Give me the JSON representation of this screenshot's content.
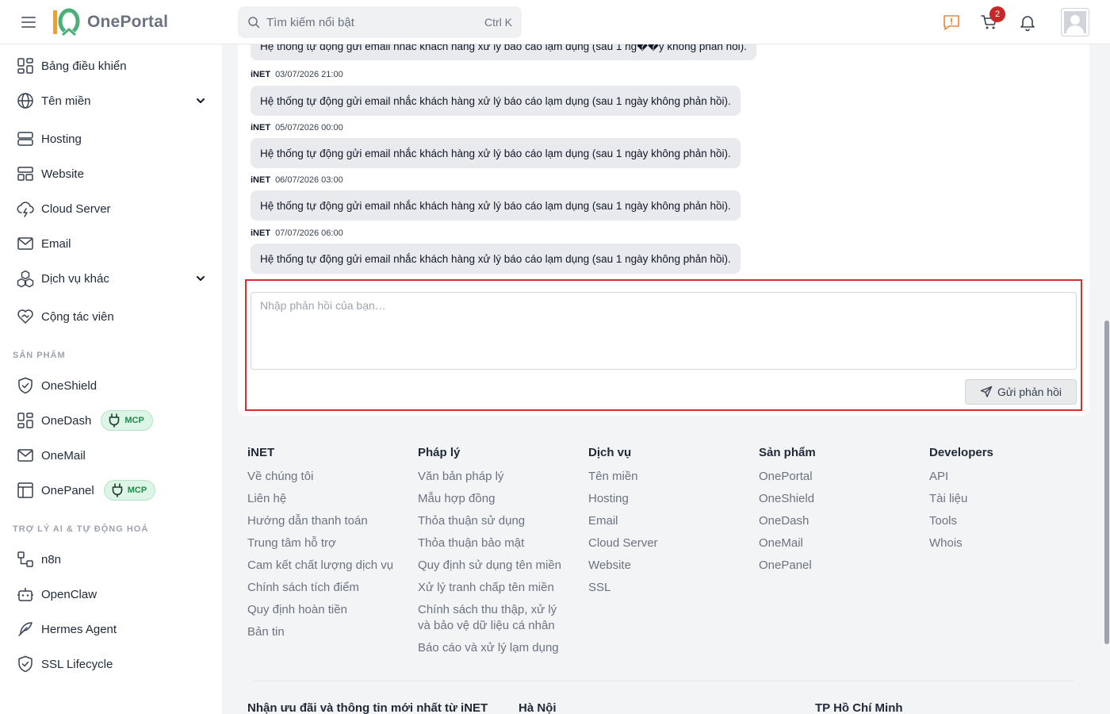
{
  "header": {
    "logo_mark": "10",
    "logo_text": "OnePortal",
    "search_placeholder": "Tìm kiếm nổi bật",
    "search_shortcut": "Ctrl K",
    "cart_count": "2"
  },
  "sidebar": {
    "items": [
      {
        "label": "Bảng điều khiển",
        "icon": "dashboard-icon"
      },
      {
        "label": "Tên miền",
        "icon": "globe-icon"
      },
      {
        "label": "Hosting",
        "icon": "server-icon"
      },
      {
        "label": "Website",
        "icon": "layout-icon"
      },
      {
        "label": "Cloud Server",
        "icon": "cloud-lightning-icon"
      },
      {
        "label": "Email",
        "icon": "mail-icon"
      },
      {
        "label": "Dịch vụ khác",
        "icon": "boxes-icon"
      },
      {
        "label": "Cộng tác viên",
        "icon": "handshake-heart-icon"
      }
    ],
    "products_title": "SẢN PHẨM",
    "products": [
      {
        "label": "OneShield",
        "icon": "shield-check-icon"
      },
      {
        "label": "OneDash",
        "icon": "dashboard-icon",
        "badge": "MCP"
      },
      {
        "label": "OneMail",
        "icon": "mail-icon"
      },
      {
        "label": "OnePanel",
        "icon": "panel-icon",
        "badge": "MCP"
      }
    ],
    "ai_title": "TRỢ LÝ AI & TỰ ĐỘNG HOÁ",
    "ai_items": [
      {
        "label": "n8n",
        "icon": "workflow-icon"
      },
      {
        "label": "OpenClaw",
        "icon": "bot-icon"
      },
      {
        "label": "Hermes Agent",
        "icon": "feather-icon"
      },
      {
        "label": "SSL Lifecycle",
        "icon": "shield-check-icon"
      }
    ]
  },
  "messages": [
    {
      "author": "",
      "time": "",
      "text": "Hệ thống tự động gửi email nhắc khách hàng xử lý báo cáo lạm dụng (sau 1 ng��y không phản hồi)."
    },
    {
      "author": "iNET",
      "time": "03/07/2026 21:00",
      "text": "Hệ thống tự động gửi email nhắc khách hàng xử lý báo cáo lạm dụng (sau 1 ngày không phản hồi)."
    },
    {
      "author": "iNET",
      "time": "05/07/2026 00:00",
      "text": "Hệ thống tự động gửi email nhắc khách hàng xử lý báo cáo lạm dụng (sau 1 ngày không phản hồi)."
    },
    {
      "author": "iNET",
      "time": "06/07/2026 03:00",
      "text": "Hệ thống tự động gửi email nhắc khách hàng xử lý báo cáo lạm dụng (sau 1 ngày không phản hồi)."
    },
    {
      "author": "iNET",
      "time": "07/07/2026 06:00",
      "text": "Hệ thống tự động gửi email nhắc khách hàng xử lý báo cáo lạm dụng (sau 1 ngày không phản hồi)."
    }
  ],
  "reply": {
    "placeholder": "Nhập phản hồi của bạn…",
    "value": "",
    "send_label": "Gửi phản hồi"
  },
  "footer": {
    "columns": [
      {
        "title": "iNET",
        "links": [
          "Về chúng tôi",
          "Liên hệ",
          "Hướng dẫn thanh toán",
          "Trung tâm hỗ trợ",
          "Cam kết chất lượng dịch vụ",
          "Chính sách tích điểm",
          "Quy định hoàn tiền",
          "Bản tin"
        ]
      },
      {
        "title": "Pháp lý",
        "links": [
          "Văn bản pháp lý",
          "Mẫu hợp đồng",
          "Thỏa thuận sử dụng",
          "Thỏa thuận bảo mật",
          "Quy định sử dụng tên miền",
          "Xử lý tranh chấp tên miền",
          "Chính sách thu thập, xử lý và bảo vệ dữ liệu cá nhân",
          "Báo cáo và xử lý lạm dụng"
        ]
      },
      {
        "title": "Dịch vụ",
        "links": [
          "Tên miền",
          "Hosting",
          "Email",
          "Cloud Server",
          "Website",
          "SSL"
        ]
      },
      {
        "title": "Sản phẩm",
        "links": [
          "OnePortal",
          "OneShield",
          "OneDash",
          "OneMail",
          "OnePanel"
        ]
      },
      {
        "title": "Developers",
        "links": [
          "API",
          "Tài liệu",
          "Tools",
          "Whois"
        ]
      }
    ],
    "newsletter_title": "Nhận ưu đãi và thông tin mới nhất từ iNET",
    "office_hanoi": "Hà Nội",
    "office_hcm": "TP Hồ Chí Minh"
  },
  "colors": {
    "highlight_border": "#d32f2f",
    "cart_badge": "#c62828",
    "mcp_badge_bg": "#dcf5e6",
    "mcp_badge_text": "#1f8a4c",
    "notice_icon": "#e8863a"
  }
}
